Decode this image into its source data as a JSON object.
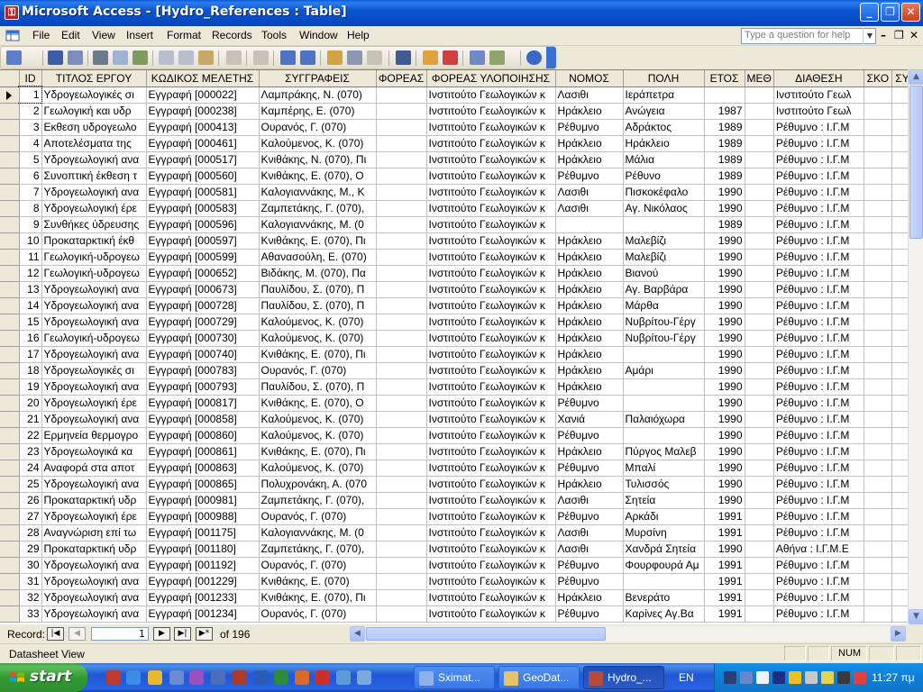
{
  "window": {
    "title": "Microsoft Access - [Hydro_References : Table]"
  },
  "menu": {
    "items": [
      "File",
      "Edit",
      "View",
      "Insert",
      "Format",
      "Records",
      "Tools",
      "Window",
      "Help"
    ],
    "ask_placeholder": "Type a question for help"
  },
  "table": {
    "columns": [
      "ID",
      "ΤΙΤΛΟΣ ΕΡΓΟΥ",
      "ΚΩΔΙΚΟΣ ΜΕΛΕΤΗΣ",
      "ΣΥΓΓΡΑΦΕΙΣ",
      "ΦΟΡΕΑΣ",
      "ΦΟΡΕΑΣ ΥΛΟΠΟΙΗΣΗΣ",
      "ΝΟΜΟΣ",
      "ΠΟΛΗ",
      "ΕΤΟΣ",
      "ΜΕΘ",
      "ΔΙΑΘΕΣΗ",
      "ΣΚΟ",
      "ΣΥΝ"
    ],
    "rows": [
      [
        "1",
        "Υδρογεωλογικές σι",
        "Εγγραφή [000022]",
        "Λαμπράκης, Ν. (070)",
        "",
        "Ινστιτούτο Γεωλογικών κ",
        "Λασιθι",
        "Ιεράπετρα",
        "",
        "",
        "Ινστιτούτο Γεωλ",
        "",
        ""
      ],
      [
        "2",
        "Γεωλογική και υδρ",
        "Εγγραφή [000238]",
        "Καμπέρης, Ε. (070)",
        "",
        "Ινστιτούτο Γεωλογικών κ",
        "Ηράκλειο",
        "Ανώγεια",
        "1987",
        "",
        "Ινστιτούτο Γεωλ",
        "",
        ""
      ],
      [
        "3",
        "Εκθεση υδρογεωλο",
        "Εγγραφή [000413]",
        "Ουρανός, Γ. (070)",
        "",
        "Ινστιτούτο Γεωλογικών κ",
        "Ρέθυμνο",
        "Αδράκτος",
        "1989",
        "",
        "Ρέθυμνο : Ι.Γ.Μ",
        "",
        ""
      ],
      [
        "4",
        "Αποτελέσματα της",
        "Εγγραφή [000461]",
        "Καλούμενος, Κ. (070)",
        "",
        "Ινστιτούτο Γεωλογικών κ",
        "Ηράκλειο",
        "Ηράκλειο",
        "1989",
        "",
        "Ρέθυμνο : Ι.Γ.Μ",
        "",
        ""
      ],
      [
        "5",
        "Υδρογεωλογική ανα",
        "Εγγραφή [000517]",
        "Κνιθάκης, Ν. (070), Πι",
        "",
        "Ινστιτούτο Γεωλογικών κ",
        "Ηράκλειο",
        "Μάλια",
        "1989",
        "",
        "Ρέθυμνο : Ι.Γ.Μ",
        "",
        ""
      ],
      [
        "6",
        "Συνοπτική έκθεση τ",
        "Εγγραφή [000560]",
        "Κνιθάκης, Ε. (070), Ο",
        "",
        "Ινστιτούτο Γεωλογικών κ",
        "Ρέθυμνο",
        "Ρέθυνο",
        "1989",
        "",
        "Ρέθυμνο : Ι.Γ.Μ",
        "",
        ""
      ],
      [
        "7",
        "Υδρογεωλογική ανα",
        "Εγγραφή [000581]",
        "Καλογιαννάκης, Μ., Κ",
        "",
        "Ινστιτούτο Γεωλογικών κ",
        "Λασιθι",
        "Πισκοκέφαλο",
        "1990",
        "",
        "Ρέθυμνο : Ι.Γ.Μ",
        "",
        ""
      ],
      [
        "8",
        "Υδρογεωλογική έρε",
        "Εγγραφή [000583]",
        "Ζαμπετάκης, Γ. (070),",
        "",
        "Ινστιτούτο Γεωλογικών κ",
        "Λασιθι",
        "Αγ. Νικόλαος",
        "1990",
        "",
        "Ρέθυμνο : Ι.Γ.Μ",
        "",
        ""
      ],
      [
        "9",
        "Συνθήκες ύδρευσης",
        "Εγγραφή [000596]",
        "Καλογιαννάκης, Μ. (0",
        "",
        "Ινστιτούτο Γεωλογικών κ",
        "",
        "",
        "1989",
        "",
        "Ρέθυμνο : Ι.Γ.Μ",
        "",
        ""
      ],
      [
        "10",
        "Προκαταρκτική έκθ",
        "Εγγραφή [000597]",
        "Κνιθάκης, Ε. (070), Πι",
        "",
        "Ινστιτούτο Γεωλογικών κ",
        "Ηράκλειο",
        "Μαλεβίζι",
        "1990",
        "",
        "Ρέθυμνο : Ι.Γ.Μ",
        "",
        ""
      ],
      [
        "11",
        "Γεωλογική-υδρογεω",
        "Εγγραφή [000599]",
        "Αθανασούλη, Ε. (070)",
        "",
        "Ινστιτούτο Γεωλογικών κ",
        "Ηράκλειο",
        "Μαλεβίζι",
        "1990",
        "",
        "Ρέθυμνο : Ι.Γ.Μ",
        "",
        ""
      ],
      [
        "12",
        "Γεωλογική-υδρογεω",
        "Εγγραφή [000652]",
        "Βιδάκης, Μ. (070), Πα",
        "",
        "Ινστιτούτο Γεωλογικών κ",
        "Ηράκλειο",
        "Βιανού",
        "1990",
        "",
        "Ρέθυμνο : Ι.Γ.Μ",
        "",
        ""
      ],
      [
        "13",
        "Υδρογεωλογική ανα",
        "Εγγραφή [000673]",
        "Παυλίδου, Σ. (070), Π",
        "",
        "Ινστιτούτο Γεωλογικών κ",
        "Ηράκλειο",
        "Αγ. Βαρβάρα",
        "1990",
        "",
        "Ρέθυμνο : Ι.Γ.Μ",
        "",
        ""
      ],
      [
        "14",
        "Υδρογεωλογική ανα",
        "Εγγραφή [000728]",
        "Παυλίδου, Σ. (070), Π",
        "",
        "Ινστιτούτο Γεωλογικών κ",
        "Ηράκλειο",
        "Μάρθα",
        "1990",
        "",
        "Ρέθυμνο : Ι.Γ.Μ",
        "",
        ""
      ],
      [
        "15",
        "Υδρογεωλογική ανα",
        "Εγγραφή [000729]",
        "Καλούμενος, Κ. (070)",
        "",
        "Ινστιτούτο Γεωλογικών κ",
        "Ηράκλειο",
        "Νυβρίτου-Γέργ",
        "1990",
        "",
        "Ρέθυμνο : Ι.Γ.Μ",
        "",
        ""
      ],
      [
        "16",
        "Γεωλογική-υδρογεω",
        "Εγγραφή [000730]",
        "Καλούμενος, Κ. (070)",
        "",
        "Ινστιτούτο Γεωλογικών κ",
        "Ηράκλειο",
        "Νυβρίτου-Γέργ",
        "1990",
        "",
        "Ρέθυμνο : Ι.Γ.Μ",
        "",
        ""
      ],
      [
        "17",
        "Υδρογεωλογική ανα",
        "Εγγραφή [000740]",
        "Κνιθάκης, Ε. (070), Πι",
        "",
        "Ινστιτούτο Γεωλογικών κ",
        "Ηράκλειο",
        "",
        "1990",
        "",
        "Ρέθυμνο : Ι.Γ.Μ",
        "",
        ""
      ],
      [
        "18",
        "Υδρογεωλογικές σι",
        "Εγγραφή [000783]",
        "Ουρανός, Γ. (070)",
        "",
        "Ινστιτούτο Γεωλογικών κ",
        "Ηράκλειο",
        "Αμάρι",
        "1990",
        "",
        "Ρέθυμνο : Ι.Γ.Μ",
        "",
        ""
      ],
      [
        "19",
        "Υδρογεωλογική ανα",
        "Εγγραφή [000793]",
        "Παυλίδου, Σ. (070), Π",
        "",
        "Ινστιτούτο Γεωλογικών κ",
        "Ηράκλειο",
        "",
        "1990",
        "",
        "Ρέθυμνο : Ι.Γ.Μ",
        "",
        ""
      ],
      [
        "20",
        "Υδρογεωλογική έρε",
        "Εγγραφή [000817]",
        "Κνιθάκης, Ε. (070), Ο",
        "",
        "Ινστιτούτο Γεωλογικών κ",
        "Ρέθυμνο",
        "",
        "1990",
        "",
        "Ρέθυμνο : Ι.Γ.Μ",
        "",
        ""
      ],
      [
        "21",
        "Υδρογεωλογική ανα",
        "Εγγραφή [000858]",
        "Καλούμενος, Κ. (070)",
        "",
        "Ινστιτούτο Γεωλογικών κ",
        "Χανιά",
        "Παλαιόχωρα",
        "1990",
        "",
        "Ρέθυμνο : Ι.Γ.Μ",
        "",
        ""
      ],
      [
        "22",
        "Ερμηνεία θερμογρο",
        "Εγγραφή [000860]",
        "Καλούμενος, Κ. (070)",
        "",
        "Ινστιτούτο Γεωλογικών κ",
        "Ρέθυμνο",
        "",
        "1990",
        "",
        "Ρέθυμνο : Ι.Γ.Μ",
        "",
        ""
      ],
      [
        "23",
        "Υδρογεωλογικά κα",
        "Εγγραφή [000861]",
        "Κνιθάκης, Ε. (070), Πι",
        "",
        "Ινστιτούτο Γεωλογικών κ",
        "Ηράκλειο",
        "Πύργος Μαλεβ",
        "1990",
        "",
        "Ρέθυμνο : Ι.Γ.Μ",
        "",
        ""
      ],
      [
        "24",
        "Αναφορά στα αποτ",
        "Εγγραφή [000863]",
        "Καλούμενος, Κ. (070)",
        "",
        "Ινστιτούτο Γεωλογικών κ",
        "Ρέθυμνο",
        "Μπαλί",
        "1990",
        "",
        "Ρέθυμνο : Ι.Γ.Μ",
        "",
        ""
      ],
      [
        "25",
        "Υδρογεωλογική ανα",
        "Εγγραφή [000865]",
        "Πολυχρονάκη, Α. (070",
        "",
        "Ινστιτούτο Γεωλογικών κ",
        "Ηράκλειο",
        "Τυλισσός",
        "1990",
        "",
        "Ρέθυμνο : Ι.Γ.Μ",
        "",
        ""
      ],
      [
        "26",
        "Προκαταρκτική υδρ",
        "Εγγραφή [000981]",
        "Ζαμπετάκης, Γ. (070),",
        "",
        "Ινστιτούτο Γεωλογικών κ",
        "Λασιθι",
        "Σητεία",
        "1990",
        "",
        "Ρέθυμνο : Ι.Γ.Μ",
        "",
        ""
      ],
      [
        "27",
        "Υδρογεωλογική έρε",
        "Εγγραφή [000988]",
        "Ουρανός, Γ. (070)",
        "",
        "Ινστιτούτο Γεωλογικών κ",
        "Ρέθυμνο",
        "Αρκάδι",
        "1991",
        "",
        "Ρέθυμνο : Ι.Γ.Μ",
        "",
        ""
      ],
      [
        "28",
        "Αναγνώριση επί τω",
        "Εγγραφή [001175]",
        "Καλογιαννάκης, Μ. (0",
        "",
        "Ινστιτούτο Γεωλογικών κ",
        "Λασιθι",
        "Μυρσίνη",
        "1991",
        "",
        "Ρέθυμνο : Ι.Γ.Μ",
        "",
        ""
      ],
      [
        "29",
        "Προκαταρκτική υδρ",
        "Εγγραφή [001180]",
        "Ζαμπετάκης, Γ. (070),",
        "",
        "Ινστιτούτο Γεωλογικών κ",
        "Λασιθι",
        "Χανδρά Σητεία",
        "1990",
        "",
        "Αθήνα : Ι.Γ.Μ.Ε",
        "",
        ""
      ],
      [
        "30",
        "Υδρογεωλογική ανα",
        "Εγγραφή [001192]",
        "Ουρανός, Γ. (070)",
        "",
        "Ινστιτούτο Γεωλογικών κ",
        "Ρέθυμνο",
        "Φουρφουρά Αμ",
        "1991",
        "",
        "Ρέθυμνο : Ι.Γ.Μ",
        "",
        ""
      ],
      [
        "31",
        "Υδρογεωλογική ανα",
        "Εγγραφή [001229]",
        "Κνιθάκης, Ε. (070)",
        "",
        "Ινστιτούτο Γεωλογικών κ",
        "Ρέθυμνο",
        "",
        "1991",
        "",
        "Ρέθυμνο : Ι.Γ.Μ",
        "",
        ""
      ],
      [
        "32",
        "Υδρογεωλογική ανα",
        "Εγγραφή [001233]",
        "Κνιθάκης, Ε. (070), Πι",
        "",
        "Ινστιτούτο Γεωλογικών κ",
        "Ηράκλειο",
        "Βενεράτο",
        "1991",
        "",
        "Ρέθυμνο : Ι.Γ.Μ",
        "",
        ""
      ],
      [
        "33",
        "Υδρογεωλογική ανα",
        "Εγγραφή [001234]",
        "Ουρανός, Γ. (070)",
        "",
        "Ινστιτούτο Γεωλογικών κ",
        "Ρέθυμνο",
        "Καρίνες Αγ.Βα",
        "1991",
        "",
        "Ρέθυμνο : Ι.Γ.Μ",
        "",
        ""
      ]
    ]
  },
  "navigation": {
    "label": "Record:",
    "current": "1",
    "of_text": "of  196"
  },
  "status": {
    "mode": "Datasheet View",
    "num": "NUM"
  },
  "taskbar": {
    "start": "start",
    "tasks": [
      "Sximat...",
      "GeoDat...",
      "Hydro_..."
    ],
    "language": "EN",
    "clock": "11:27 πμ"
  },
  "colors": {
    "title_blue": "#0A55D0",
    "start_green": "#3C9E3C",
    "tray_blue": "#0F81DB",
    "face": "#ECE9D8"
  }
}
